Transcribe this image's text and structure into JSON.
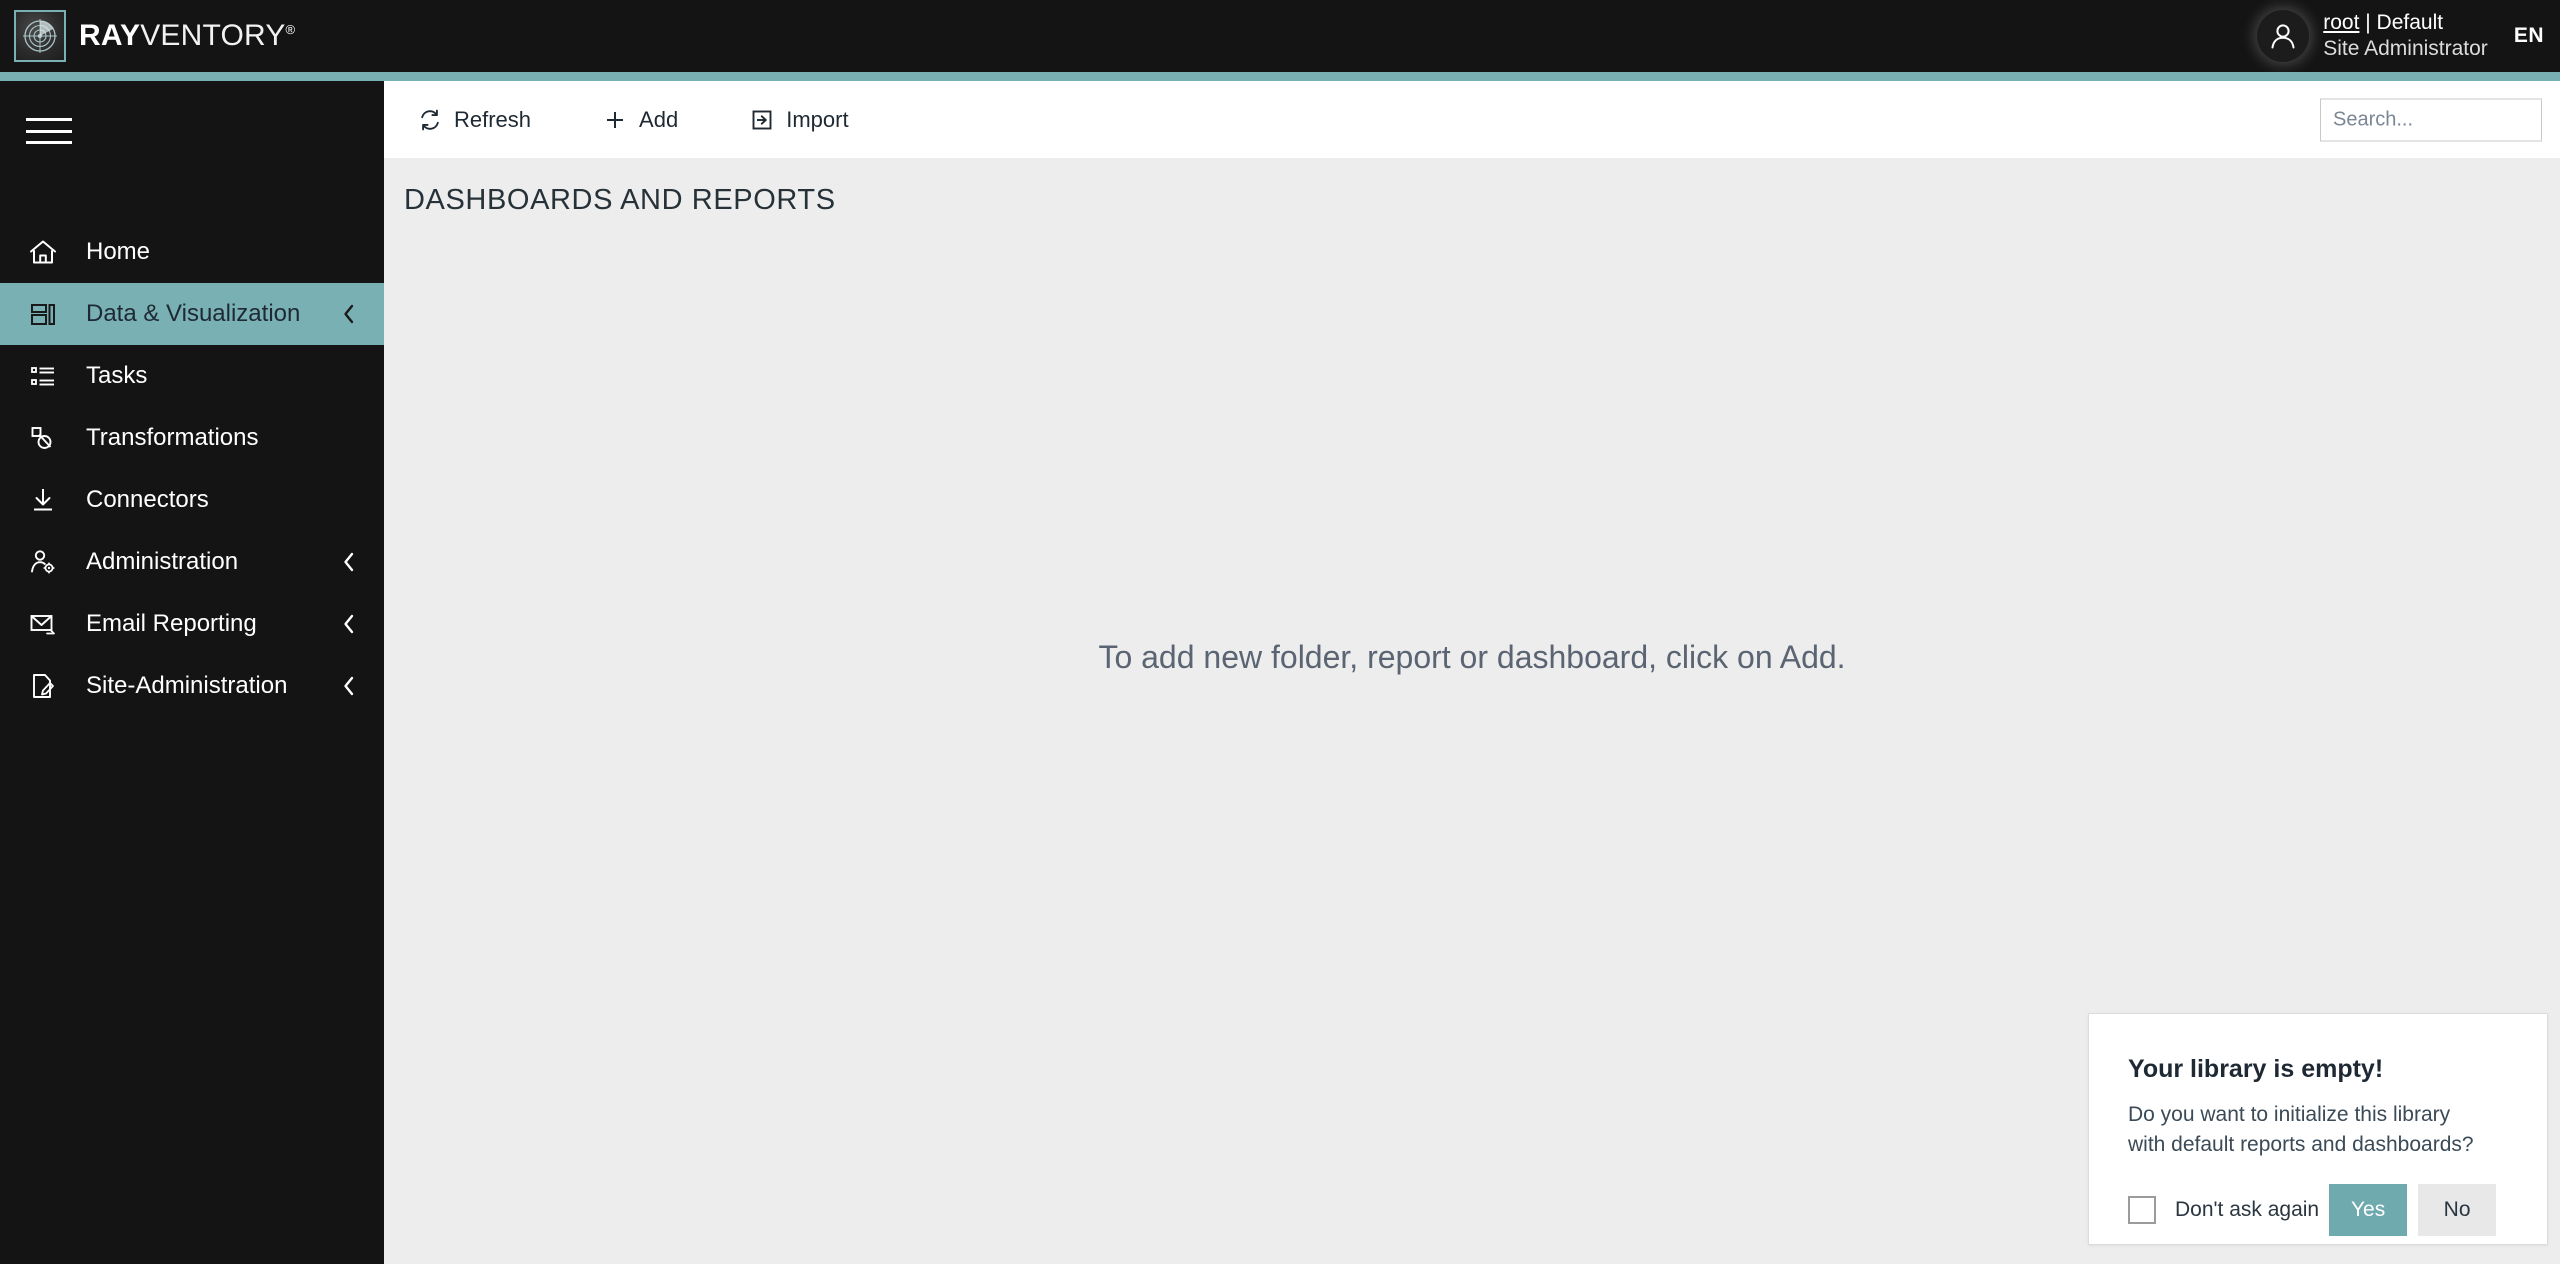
{
  "brand": {
    "logo_icon": "radar-icon",
    "name_bold": "RAY",
    "name_light": "VENTORY",
    "registered_mark": "®"
  },
  "header": {
    "avatar_icon": "user-avatar-icon",
    "user_name": "root",
    "user_separator": " | ",
    "tenant": "Default",
    "role": "Site Administrator",
    "language": "EN"
  },
  "sidebar": {
    "menu_icon": "hamburger-menu-icon",
    "items": [
      {
        "label": "Home",
        "icon": "home-icon",
        "active": false,
        "chevron": false
      },
      {
        "label": "Data & Visualization",
        "icon": "dashboard-icon",
        "active": true,
        "chevron": true
      },
      {
        "label": "Tasks",
        "icon": "task-list-icon",
        "active": false,
        "chevron": false
      },
      {
        "label": "Transformations",
        "icon": "transformations-icon",
        "active": false,
        "chevron": false
      },
      {
        "label": "Connectors",
        "icon": "download-connector-icon",
        "active": false,
        "chevron": false
      },
      {
        "label": "Administration",
        "icon": "user-gear-icon",
        "active": false,
        "chevron": true
      },
      {
        "label": "Email Reporting",
        "icon": "email-arrow-icon",
        "active": false,
        "chevron": true
      },
      {
        "label": "Site-Administration",
        "icon": "document-pen-icon",
        "active": false,
        "chevron": true
      }
    ]
  },
  "toolbar": {
    "refresh_label": "Refresh",
    "refresh_icon": "refresh-icon",
    "add_label": "Add",
    "add_icon": "plus-icon",
    "import_label": "Import",
    "import_icon": "import-icon",
    "search_placeholder": "Search...",
    "search_value": "",
    "search_icon": "search-icon"
  },
  "main": {
    "page_title": "DASHBOARDS AND REPORTS",
    "empty_message": "To add new folder, report or dashboard, click on Add."
  },
  "dialog": {
    "title": "Your library is empty!",
    "message": "Do you want to initialize this library with default reports and dashboards?",
    "checkbox_label": "Don't ask again",
    "checkbox_checked": false,
    "yes_label": "Yes",
    "no_label": "No"
  },
  "colors": {
    "accent_teal": "#79b0b4",
    "header_dark": "#141414",
    "content_gray": "#ededed",
    "button_primary": "#6eaaae",
    "button_secondary": "#e8e8e8"
  }
}
